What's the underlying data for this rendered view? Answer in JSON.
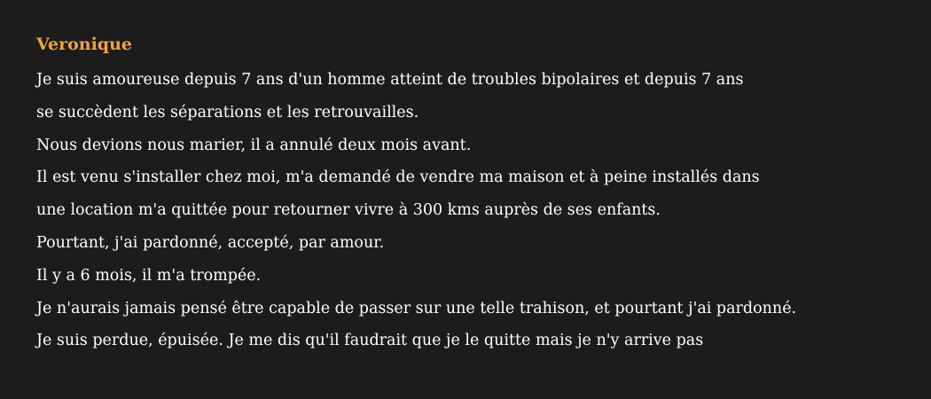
{
  "post": {
    "author": "Veronique",
    "lines": [
      "Je suis amoureuse depuis 7 ans d'un homme atteint de troubles bipolaires et depuis 7 ans",
      "se succèdent les séparations et les retrouvailles.",
      "Nous devions nous marier, il a annulé deux mois avant.",
      "Il est venu s'installer chez moi, m'a demandé de vendre ma maison et à peine installés dans",
      "une location m'a quittée pour retourner vivre à 300 kms auprès de ses enfants.",
      "Pourtant, j'ai pardonné, accepté, par amour.",
      "Il y a 6 mois, il m'a trompée.",
      "Je n'aurais jamais pensé être capable de passer sur une telle trahison, et pourtant j'ai pardonné.",
      "Je suis perdue, épuisée. Je me dis qu'il faudrait que je le quitte mais je n'y arrive pas"
    ]
  },
  "colors": {
    "background": "#1c1c1c",
    "author": "#f2a33c",
    "text": "#ffffff"
  }
}
